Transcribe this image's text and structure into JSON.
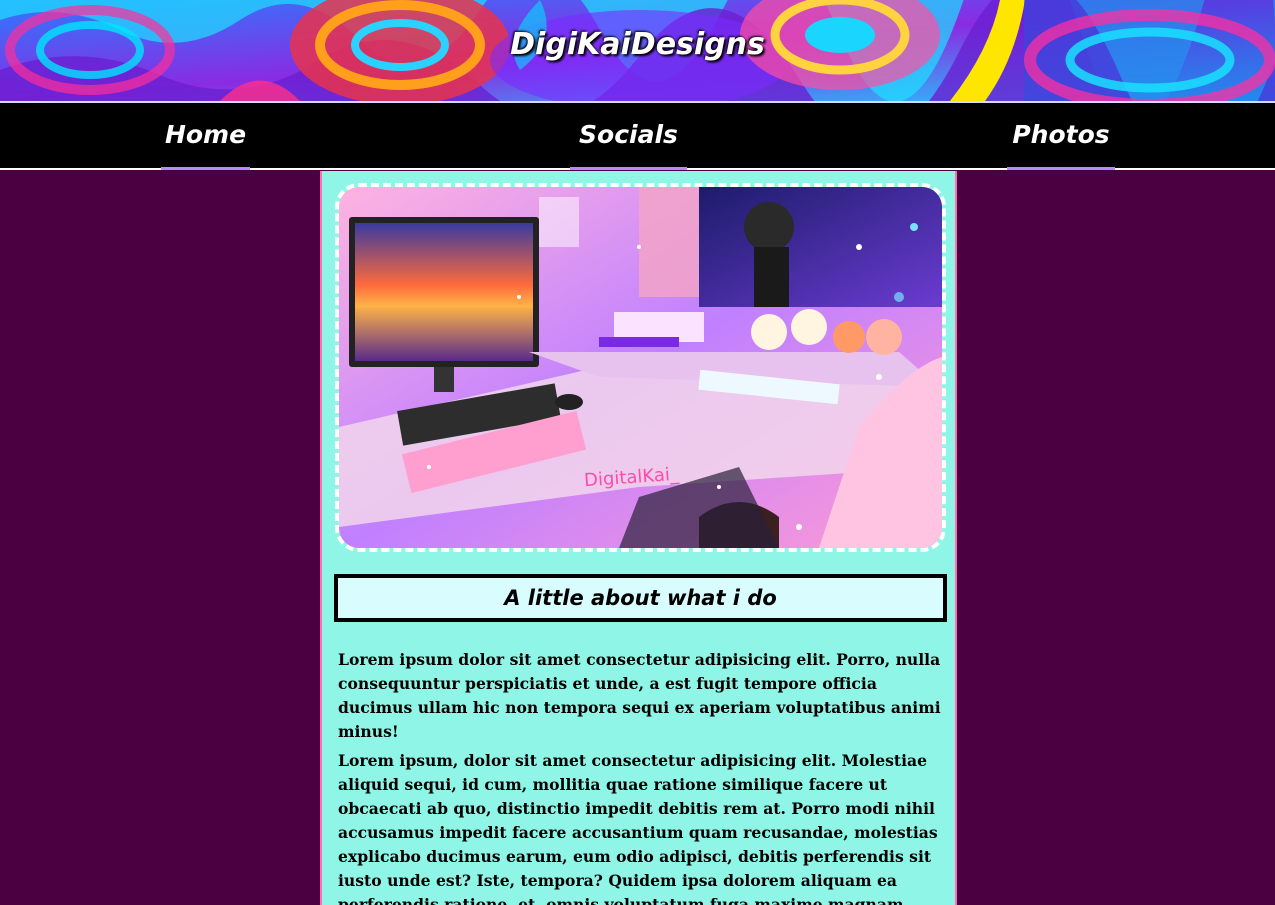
{
  "header": {
    "site_title": "DigiKaiDesigns"
  },
  "nav": {
    "items": [
      {
        "label": "Home"
      },
      {
        "label": "Socials"
      },
      {
        "label": "Photos"
      }
    ]
  },
  "main": {
    "image_watermark": "DigitalKai_",
    "section_heading": "A little about what i do",
    "paragraphs": [
      "Lorem ipsum dolor sit amet consectetur adipisicing elit. Porro, nulla consequuntur perspiciatis et unde, a est fugit tempore officia ducimus ullam hic non tempora sequi ex aperiam voluptatibus animi minus!",
      "Lorem ipsum, dolor sit amet consectetur adipisicing elit. Molestiae aliquid sequi, id cum, mollitia quae ratione similique facere ut obcaecati ab quo, distinctio impedit debitis rem at. Porro modi nihil accusamus impedit facere accusantium quam recusandae, molestias explicabo ducimus earum, eum odio adipisci, debitis perferendis sit iusto unde est? Iste, tempora? Quidem ipsa dolorem aliquam ea perferendis ratione, et, omnis voluptatum fuga maxime magnam eveniet perspiciatis, velit cum. Quo"
    ]
  },
  "colors": {
    "page_background": "#4a0041",
    "content_background": "#8ff5e6",
    "heading_box_background": "#d9fdff",
    "nav_background": "#000000",
    "nav_underline": "#b28cff",
    "content_border": "#ff6fb0"
  }
}
